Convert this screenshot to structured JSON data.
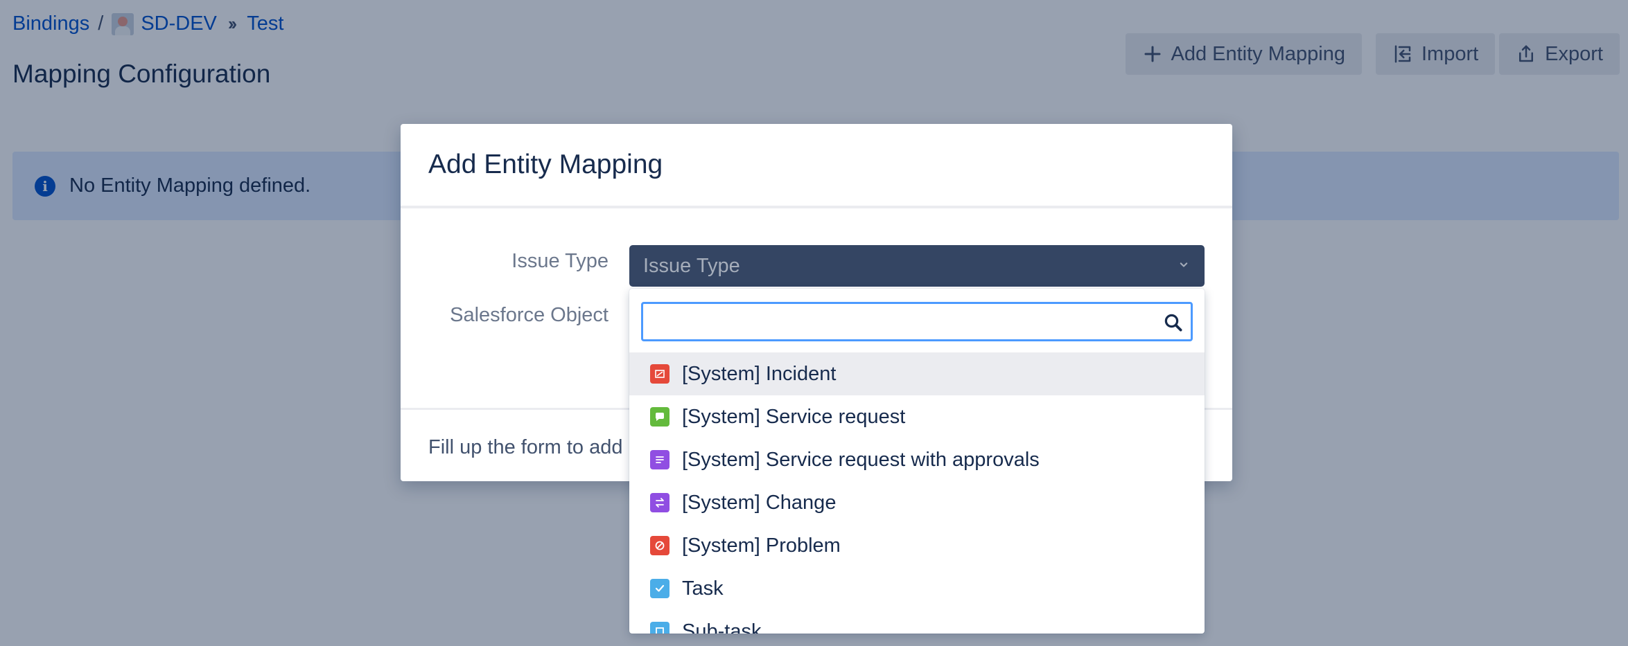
{
  "breadcrumb": {
    "root": "Bindings",
    "separator": "/",
    "project": "SD-DEV",
    "current": "Test"
  },
  "page": {
    "title": "Mapping Configuration"
  },
  "toolbar": {
    "add_label": "Add Entity Mapping",
    "import_label": "Import",
    "export_label": "Export"
  },
  "info": {
    "message": "No Entity Mapping defined."
  },
  "modal": {
    "title": "Add Entity Mapping",
    "issue_type_label": "Issue Type",
    "issue_type_placeholder": "Issue Type",
    "salesforce_object_label": "Salesforce Object",
    "footer_text": "Fill up the form to add"
  },
  "dropdown": {
    "search_value": "",
    "options": [
      {
        "label": "[System] Incident",
        "icon": "incident-icon",
        "color": "#e5493a"
      },
      {
        "label": "[System] Service request",
        "icon": "service-request-icon",
        "color": "#63ba3c"
      },
      {
        "label": "[System] Service request with approvals",
        "icon": "approvals-icon",
        "color": "#904ee2"
      },
      {
        "label": "[System] Change",
        "icon": "change-icon",
        "color": "#904ee2"
      },
      {
        "label": "[System] Problem",
        "icon": "problem-icon",
        "color": "#e5493a"
      },
      {
        "label": "Task",
        "icon": "task-icon",
        "color": "#4bade8"
      },
      {
        "label": "Sub-task",
        "icon": "subtask-icon",
        "color": "#4bade8"
      }
    ]
  },
  "colors": {
    "link": "#0052cc",
    "overlay": "rgba(9,30,66,0.42)",
    "select_bg": "#344563",
    "focus": "#4c9aff"
  }
}
